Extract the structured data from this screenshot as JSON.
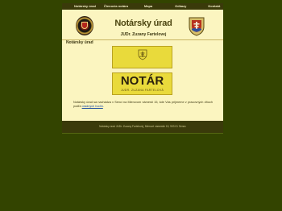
{
  "nav": {
    "items": [
      "Notársky úrad",
      "Členovia notára",
      "Mapa",
      "Odkazy",
      "Kontakt"
    ]
  },
  "header": {
    "title": "Notársky úrad",
    "subtitle": "JUDr. Zuzany Fartelovej"
  },
  "breadcrumb": "Notársky úrad",
  "plates": {
    "top_caption": "",
    "main": "NOTÁR",
    "bottom_caption": "JUDR. ZUZANA FARTELOVÁ"
  },
  "body": {
    "text": "Notársky úrad sa nachádza v Senci na Mierovom námestí 15, kde Vás prijmeme v pracovných dňoch podľa",
    "link": "úradných hodín",
    "end": "."
  },
  "footer": {
    "text": "Notársky úrad JUDr. Zuzany Fartelovej, Mierové námestie 15, 903 01 Senec"
  },
  "colors": {
    "background": "#334400",
    "page": "#fbf5c0",
    "nav": "#3a3a0a",
    "plate": "#e9da3b"
  }
}
